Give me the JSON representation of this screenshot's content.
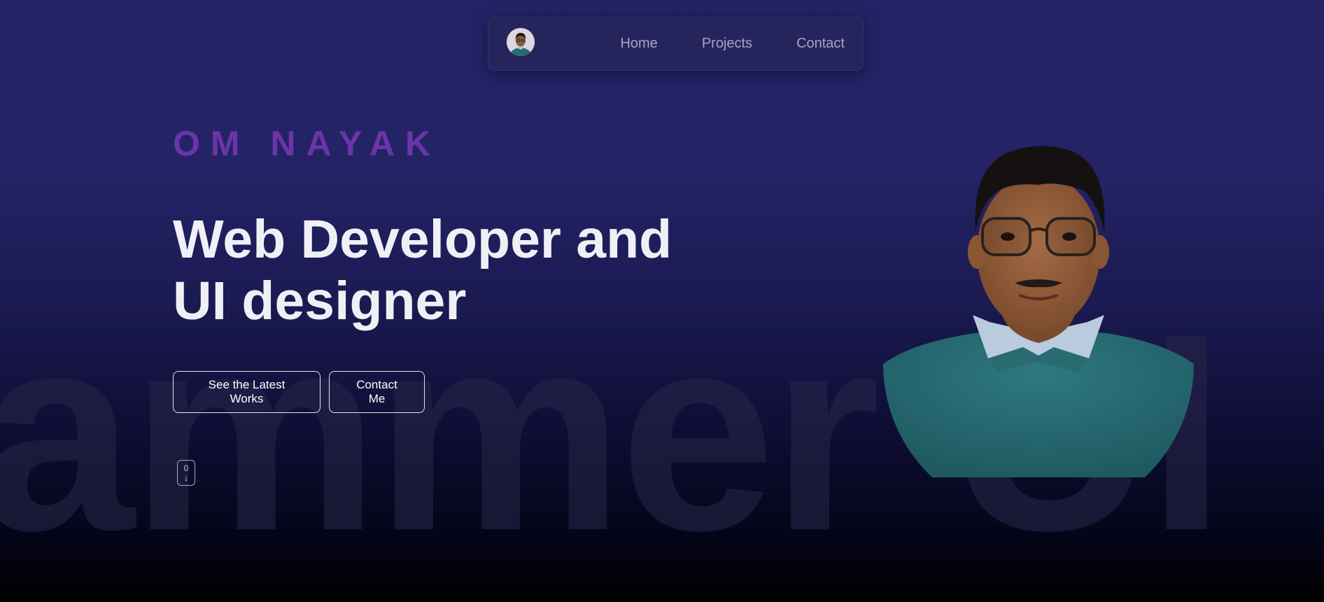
{
  "background_text": "ammer UI",
  "navbar": {
    "links": [
      {
        "label": "Home"
      },
      {
        "label": "Projects"
      },
      {
        "label": "Contact"
      }
    ]
  },
  "hero": {
    "name": "OM NAYAK",
    "title_line1": "Web Developer and",
    "title_line2": "UI designer",
    "buttons": {
      "works_label": "See the Latest Works",
      "contact_label": "Contact Me"
    },
    "scroll_indicator": {
      "count": "0",
      "arrow": "↓"
    }
  },
  "icons": {
    "scroll": "mouse-scroll-icon",
    "avatar": "avatar-portrait"
  },
  "colors": {
    "background_top": "#232265",
    "background_bottom": "#000000",
    "name_accent": "#6a35a8",
    "title_text": "#f1eff6",
    "nav_text": "#a6a6c0",
    "shirt": "#2a6b72"
  }
}
